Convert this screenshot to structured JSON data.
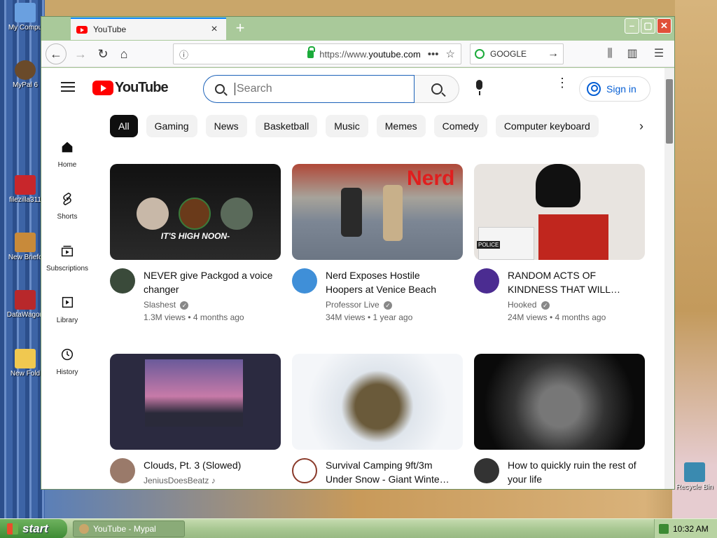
{
  "desktop": {
    "icons_left": [
      {
        "label": "My Compu",
        "color": "#6aa0e0"
      },
      {
        "label": "MyPal 6",
        "color": "#6a4a2a"
      },
      {
        "label": "filezilla311",
        "color": "#c8262b"
      },
      {
        "label": "New Briefc",
        "color": "#c88a3a"
      },
      {
        "label": "DataWagon",
        "color": "#b8282b"
      },
      {
        "label": "New Fold",
        "color": "#f0c850"
      }
    ],
    "icons_right": [
      {
        "label": "Recycle Bin",
        "color": "#3a8ab0"
      }
    ]
  },
  "browser": {
    "tab_title": "YouTube",
    "new_tab": "+",
    "url_prefix": "https://www.",
    "url_host": "youtube.com",
    "search_engine": "GOOGLE",
    "window_controls": {
      "minimize": "–",
      "maximize": "▢",
      "close": "✕"
    }
  },
  "youtube": {
    "logo_text": "YouTube",
    "search_placeholder": "Search",
    "signin_label": "Sign in",
    "rail": [
      {
        "label": "Home",
        "icon": "home-icon"
      },
      {
        "label": "Shorts",
        "icon": "shorts-icon"
      },
      {
        "label": "Subscriptions",
        "icon": "subscriptions-icon"
      },
      {
        "label": "Library",
        "icon": "library-icon"
      },
      {
        "label": "History",
        "icon": "history-icon"
      }
    ],
    "chips": [
      "All",
      "Gaming",
      "News",
      "Basketball",
      "Music",
      "Memes",
      "Comedy",
      "Computer keyboard"
    ],
    "videos": [
      {
        "title": "NEVER give Packgod a voice changer",
        "channel": "Slashest",
        "verified": true,
        "stats": "1.3M views • 4 months ago",
        "thumb_colors": [
          "#111111",
          "#2a2a2a"
        ],
        "avatar_color": "#3a4a3a",
        "overlay": "IT'S HIGH NOON-"
      },
      {
        "title": "Nerd Exposes Hostile Hoopers at Venice Beach",
        "channel": "Professor Live",
        "verified": true,
        "stats": "34M views • 1 year ago",
        "thumb_colors": [
          "#8a97a8",
          "#6c7684"
        ],
        "avatar_color": "#3f8fd8",
        "overlay": "Nerd"
      },
      {
        "title": "RANDOM ACTS OF KINDNESS THAT WILL…",
        "channel": "Hooked",
        "verified": true,
        "stats": "24M views • 4 months ago",
        "thumb_colors": [
          "#e8e8e8",
          "#c0261e"
        ],
        "avatar_color": "#4b2c91",
        "overlay": "POLICE"
      },
      {
        "title": "Clouds, Pt. 3 (Slowed)",
        "channel": "JeniusDoesBeatz",
        "verified": false,
        "stats": "",
        "thumb_colors": [
          "#2b2a40",
          "#c77aa8"
        ],
        "avatar_color": "#9a7a6a",
        "overlay": ""
      },
      {
        "title": "Survival Camping 9ft/3m Under Snow - Giant Winte…",
        "channel": "",
        "verified": false,
        "stats": "",
        "thumb_colors": [
          "#eef2f6",
          "#b8c2cc"
        ],
        "avatar_color": "#ffffff",
        "overlay": ""
      },
      {
        "title": "How to quickly ruin the rest of your life",
        "channel": "",
        "verified": false,
        "stats": "",
        "thumb_colors": [
          "#111111",
          "#555555"
        ],
        "avatar_color": "#333333",
        "overlay": ""
      }
    ]
  },
  "taskbar": {
    "start_label": "start",
    "task_label": "YouTube - Mypal",
    "clock": "10:32 AM"
  }
}
